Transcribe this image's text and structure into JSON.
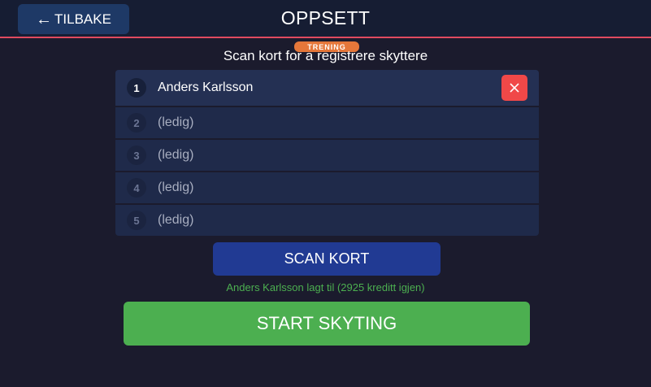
{
  "header": {
    "back_arrow": "←",
    "back_label": "TILBAKE",
    "title": "OPPSETT"
  },
  "mode_badge": "TRENING",
  "instruction": "Scan kort for a registrere skyttere",
  "slots": [
    {
      "number": "1",
      "name": "Anders Karlsson",
      "filled": true
    },
    {
      "number": "2",
      "name": "(ledig)",
      "filled": false
    },
    {
      "number": "3",
      "name": "(ledig)",
      "filled": false
    },
    {
      "number": "4",
      "name": "(ledig)",
      "filled": false
    },
    {
      "number": "5",
      "name": "(ledig)",
      "filled": false
    }
  ],
  "scan_button_label": "SCAN KORT",
  "status_message": "Anders Karlsson lagt til (2925 kreditt igjen)",
  "start_button_label": "START SKYTING",
  "colors": {
    "accent_line": "#e04a5f",
    "badge": "#e5773a",
    "remove": "#f04848",
    "scan": "#213a93",
    "start": "#4caf50",
    "status": "#4caf50"
  },
  "icons": {
    "remove": "close-icon",
    "back": "arrow-left-icon"
  }
}
